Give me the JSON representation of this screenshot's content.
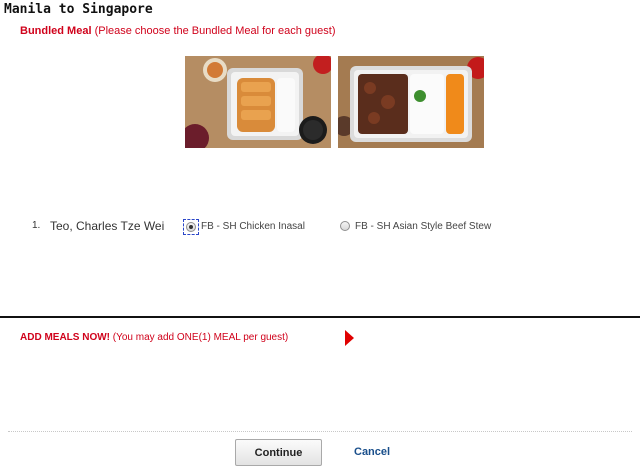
{
  "route": {
    "title": "Manila  to  Singapore"
  },
  "bundled": {
    "label": "Bundled Meal",
    "note": "(Please choose the Bundled Meal for each guest)"
  },
  "images": [
    {
      "icon": "chicken-inasal-meal-photo"
    },
    {
      "icon": "beef-stew-meal-photo"
    }
  ],
  "guests": [
    {
      "number": "1.",
      "name": "Teo, Charles Tze Wei",
      "options": [
        {
          "label": "FB - SH Chicken Inasal",
          "selected": true
        },
        {
          "label": "FB - SH Asian Style Beef Stew",
          "selected": false
        }
      ]
    }
  ],
  "add_meals": {
    "label": "ADD MEALS NOW!",
    "note": "(You may add ONE(1) MEAL per guest)"
  },
  "buttons": {
    "continue": "Continue",
    "cancel": "Cancel"
  },
  "colors": {
    "accent_red": "#d0021b",
    "link_blue": "#1a4f8b"
  }
}
